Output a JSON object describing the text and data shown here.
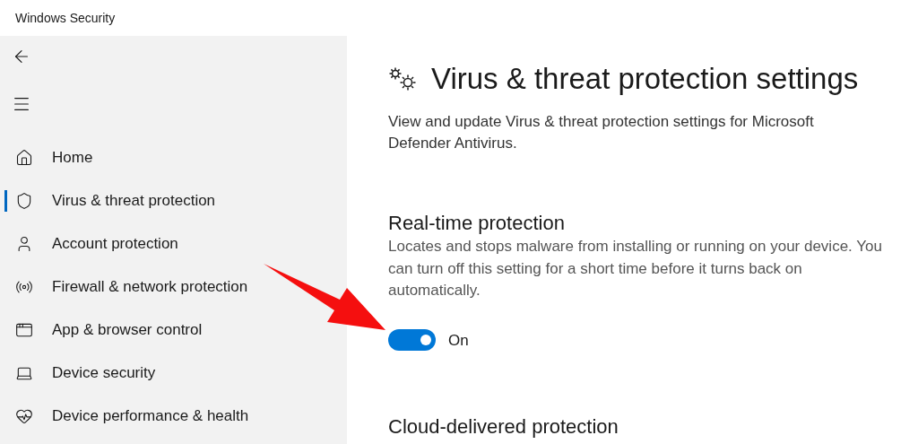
{
  "window": {
    "title": "Windows Security"
  },
  "sidebar": {
    "items": [
      {
        "label": "Home",
        "selected": false
      },
      {
        "label": "Virus & threat protection",
        "selected": true
      },
      {
        "label": "Account protection",
        "selected": false
      },
      {
        "label": "Firewall & network protection",
        "selected": false
      },
      {
        "label": "App & browser control",
        "selected": false
      },
      {
        "label": "Device security",
        "selected": false
      },
      {
        "label": "Device performance & health",
        "selected": false
      }
    ]
  },
  "page": {
    "title": "Virus & threat protection settings",
    "description": "View and update Virus & threat protection settings for Microsoft Defender Antivirus.",
    "sections": [
      {
        "heading": "Real-time protection",
        "body": "Locates and stops malware from installing or running on your device. You can turn off this setting for a short time before it turns back on automatically.",
        "toggle": {
          "on": true,
          "label": "On"
        }
      },
      {
        "heading": "Cloud-delivered protection"
      }
    ]
  }
}
